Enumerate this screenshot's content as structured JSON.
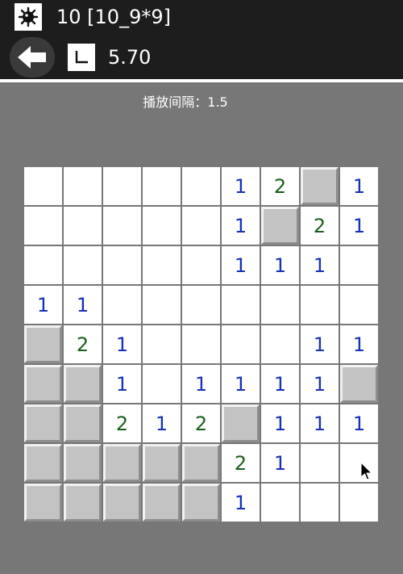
{
  "header": {
    "mine_count_title": "10  [10_9*9]",
    "timer": "5.70",
    "icons": {
      "mine": "mine-icon",
      "back": "back-arrow-icon",
      "timer": "timer-icon"
    }
  },
  "interval_label": "播放间隔：1.5",
  "colors": {
    "number1": "#1630b8",
    "number2": "#1b5e1b",
    "background": "#777777",
    "closed_cell": "#c3c3c3"
  },
  "board": {
    "rows": 9,
    "cols": 9,
    "legend": "C = covered cell, empty string = opened blank, digits = opened number",
    "cells": [
      [
        "",
        "",
        "",
        "",
        "",
        "1",
        "2",
        "C",
        "1"
      ],
      [
        "",
        "",
        "",
        "",
        "",
        "1",
        "C",
        "2",
        "1"
      ],
      [
        "",
        "",
        "",
        "",
        "",
        "1",
        "1",
        "1",
        ""
      ],
      [
        "1",
        "1",
        "",
        "",
        "",
        "",
        "",
        "",
        ""
      ],
      [
        "C",
        "2",
        "1",
        "",
        "",
        "",
        "",
        "1",
        "1"
      ],
      [
        "C",
        "C",
        "1",
        "",
        "1",
        "1",
        "1",
        "1",
        "C"
      ],
      [
        "C",
        "C",
        "2",
        "1",
        "2",
        "C",
        "1",
        "1",
        "1"
      ],
      [
        "C",
        "C",
        "C",
        "C",
        "C",
        "2",
        "1",
        "",
        ""
      ],
      [
        "C",
        "C",
        "C",
        "C",
        "C",
        "1",
        "",
        "",
        ""
      ]
    ]
  }
}
